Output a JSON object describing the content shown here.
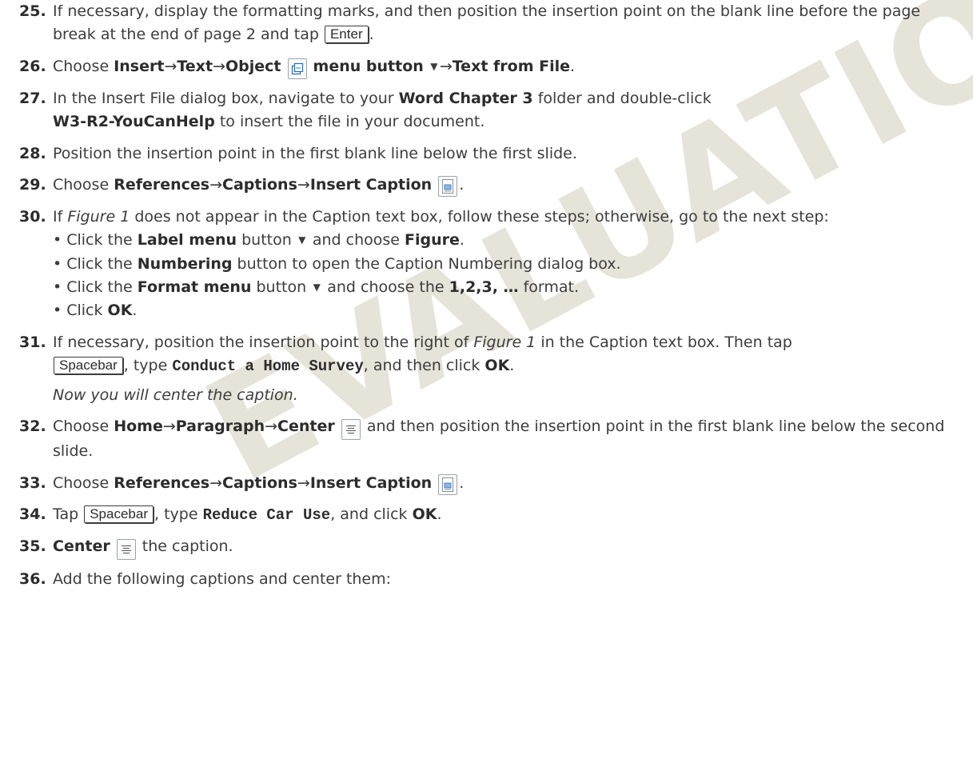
{
  "watermark": "EVALUATION ONLY",
  "arrow": "→",
  "colors": {
    "watermark": "#e6e3d9",
    "text": "#3c3c3c"
  },
  "steps": [
    {
      "num": "25.",
      "a": "If necessary, display the formatting marks, and then position the insertion point on the blank line before the page break at the end of page 2 and tap ",
      "key": "Enter",
      "b": "."
    },
    {
      "num": "26.",
      "a": "Choose ",
      "p1": "Insert",
      "p2": "Text",
      "p3": "Object",
      "p4": "menu button",
      "p5": "Text from File",
      "b": ".",
      "icon": "object-icon"
    },
    {
      "num": "27.",
      "a": "In the Insert File dialog box, navigate to your ",
      "b1": "Word Chapter 3",
      "c": " folder and double-click ",
      "b2": "W3-R2-YouCanHelp",
      "d": " to insert the file in your document."
    },
    {
      "num": "28.",
      "a": "Position the insertion point in the first blank line below the first slide."
    },
    {
      "num": "29.",
      "a": "Choose ",
      "p1": "References",
      "p2": "Captions",
      "p3": "Insert Caption",
      "b": ".",
      "icon": "insert-caption-icon"
    },
    {
      "num": "30.",
      "a": "If ",
      "i1": "Figure 1",
      "b": " does not appear in the Caption text box, follow these steps; otherwise, go to the next step:",
      "bullets": [
        {
          "a": "Click the ",
          "b": "Label menu",
          "c": " button ",
          "d": " and choose ",
          "e": "Figure",
          "f": "."
        },
        {
          "a": "Click the ",
          "b": "Numbering",
          "c": " button to open the Caption Numbering dialog box."
        },
        {
          "a": "Click the ",
          "b": "Format menu",
          "c": " button ",
          "d": " and choose the ",
          "e": "1,2,3, …",
          "f": " format."
        },
        {
          "a": "Click ",
          "b": "OK",
          "c": "."
        }
      ]
    },
    {
      "num": "31.",
      "a": "If necessary, position the insertion point to the right of ",
      "i1": "Figure 1",
      "b": " in the Caption text box. Then tap ",
      "key": "Spacebar",
      "c": ", type ",
      "code": "Conduct a Home Survey",
      "d": ", and then click ",
      "ok": "OK",
      "e": ".",
      "note": "Now you will center the caption."
    },
    {
      "num": "32.",
      "a": "Choose ",
      "p1": "Home",
      "p2": "Paragraph",
      "p3": "Center",
      "b": " and then position the insertion point in the first blank line below the second slide.",
      "icon": "center-align-icon"
    },
    {
      "num": "33.",
      "a": "Choose ",
      "p1": "References",
      "p2": "Captions",
      "p3": "Insert Caption",
      "b": ".",
      "icon": "insert-caption-icon"
    },
    {
      "num": "34.",
      "a": "Tap ",
      "key": "Spacebar",
      "c": ", type ",
      "code": "Reduce Car Use",
      "d": ", and click ",
      "ok": "OK",
      "e": "."
    },
    {
      "num": "35.",
      "b1": "Center",
      "c": " the caption.",
      "icon": "center-align-icon"
    },
    {
      "num": "36.",
      "a": "Add the following captions and center them:"
    }
  ]
}
